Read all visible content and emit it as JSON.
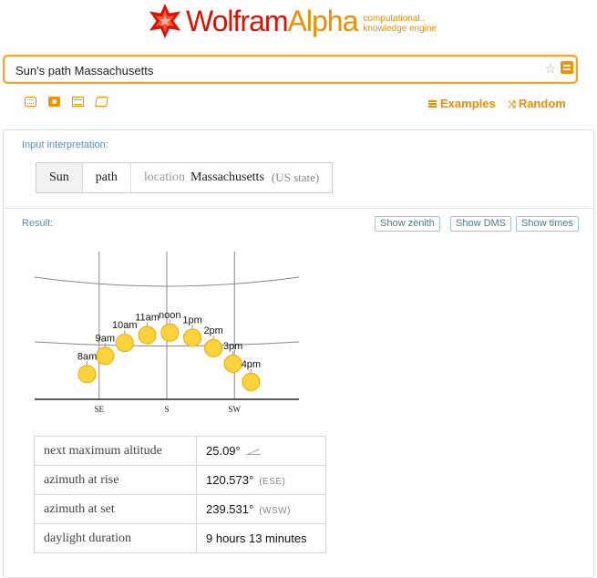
{
  "header": {
    "logo_word1": "Wolfram",
    "logo_word2": "Alpha",
    "tagline_line1": "computational..",
    "tagline_line2": "knowledge engine",
    "brand_color": "#dd1100",
    "accent_color": "#f08c00"
  },
  "search": {
    "value": "Sun's path Massachusetts",
    "favorite_icon": "star-icon",
    "submit_icon": "equals-icon"
  },
  "toolbar": {
    "icons": [
      "keyboard-icon",
      "camera-icon",
      "table-icon",
      "gallery-icon"
    ],
    "examples_label": "Examples",
    "random_label": "Random"
  },
  "input_interpretation": {
    "title": "Input interpretation:",
    "cells": {
      "sun": "Sun",
      "path": "path",
      "location_label": "location",
      "location_value": "Massachusetts",
      "location_type": "(US state)"
    }
  },
  "result": {
    "title": "Result:",
    "buttons": {
      "show_zenith": "Show zenith",
      "show_dms": "Show DMS",
      "show_times": "Show times"
    }
  },
  "chart_data": {
    "type": "scatter",
    "title": "",
    "xlabel": "",
    "ylabel": "",
    "direction_labels": [
      "SE",
      "S",
      "SW"
    ],
    "points": [
      {
        "label": "8am",
        "azimuth": 127,
        "altitude": 9
      },
      {
        "label": "9am",
        "azimuth": 139,
        "altitude": 16
      },
      {
        "label": "10am",
        "azimuth": 152,
        "altitude": 21
      },
      {
        "label": "11am",
        "azimuth": 167,
        "altitude": 24
      },
      {
        "label": "noon",
        "azimuth": 182,
        "altitude": 25
      },
      {
        "label": "1pm",
        "azimuth": 197,
        "altitude": 23
      },
      {
        "label": "2pm",
        "azimuth": 211,
        "altitude": 19
      },
      {
        "label": "3pm",
        "azimuth": 224,
        "altitude": 13
      },
      {
        "label": "4pm",
        "azimuth": 236,
        "altitude": 6
      }
    ],
    "sun_color": "#fdd33b"
  },
  "details": {
    "rows": [
      {
        "label": "next maximum altitude",
        "value": "25.09°",
        "note": ""
      },
      {
        "label": "azimuth at rise",
        "value": "120.573°",
        "note": "(ESE)"
      },
      {
        "label": "azimuth at set",
        "value": "239.531°",
        "note": "(WSW)"
      },
      {
        "label": "daylight duration",
        "value": "9 hours 13 minutes",
        "note": ""
      }
    ]
  }
}
